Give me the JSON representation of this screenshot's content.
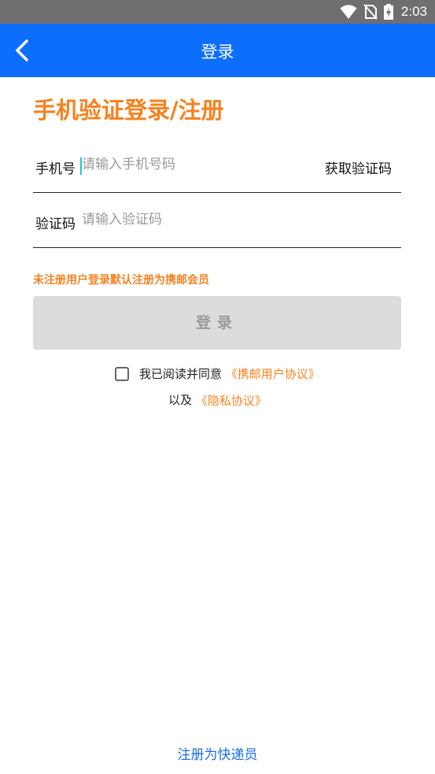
{
  "status_bar": {
    "time": "2:03"
  },
  "app_bar": {
    "title": "登录",
    "back_icon": "chevron-left-icon"
  },
  "headline": "手机验证登录/注册",
  "phone": {
    "label": "手机号",
    "placeholder": "请输入手机号码",
    "get_code": "获取验证码"
  },
  "code": {
    "label": "验证码",
    "placeholder": "请输入验证码"
  },
  "notice": "未注册用户登录默认注册为携邮会员",
  "login_button": "登录",
  "agreement": {
    "prefix": "我已阅读并同意",
    "user_agreement": "《携邮用户协议》",
    "and": "以及",
    "privacy": "《隐私协议》"
  },
  "register_courier": "注册为快递员",
  "colors": {
    "app_bar": "#0d6efd",
    "accent": "#f5821f",
    "link": "#1a6fe0",
    "button_disabled": "#dcdcdc"
  }
}
